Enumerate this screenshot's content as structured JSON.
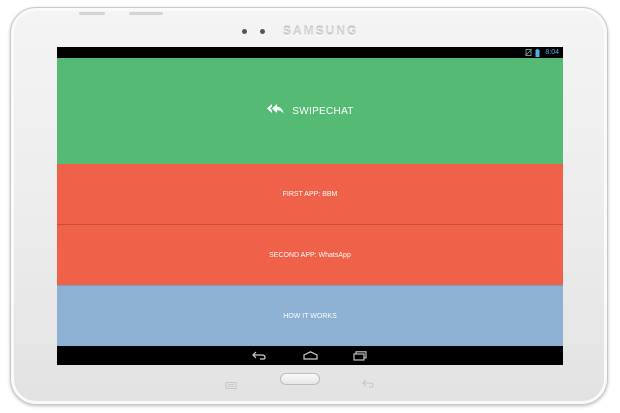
{
  "device": {
    "brand": "SAMSUNG"
  },
  "status_bar": {
    "time": "8:04",
    "icons": [
      "no-sim-icon",
      "battery-icon"
    ]
  },
  "app": {
    "title": "SWIPECHAT",
    "title_icon": "double-reply-arrow-icon",
    "first_app_label": "FIRST APP: BBM",
    "second_app_label": "SECOND APP: WhatsApp",
    "how_it_works_label": "HOW IT WORKS",
    "colors": {
      "main": "#55ba73",
      "apps": "#f06149",
      "how": "#8cb1d3"
    }
  },
  "nav_bar": {
    "buttons": [
      "back-icon",
      "home-icon",
      "recent-apps-icon"
    ]
  }
}
